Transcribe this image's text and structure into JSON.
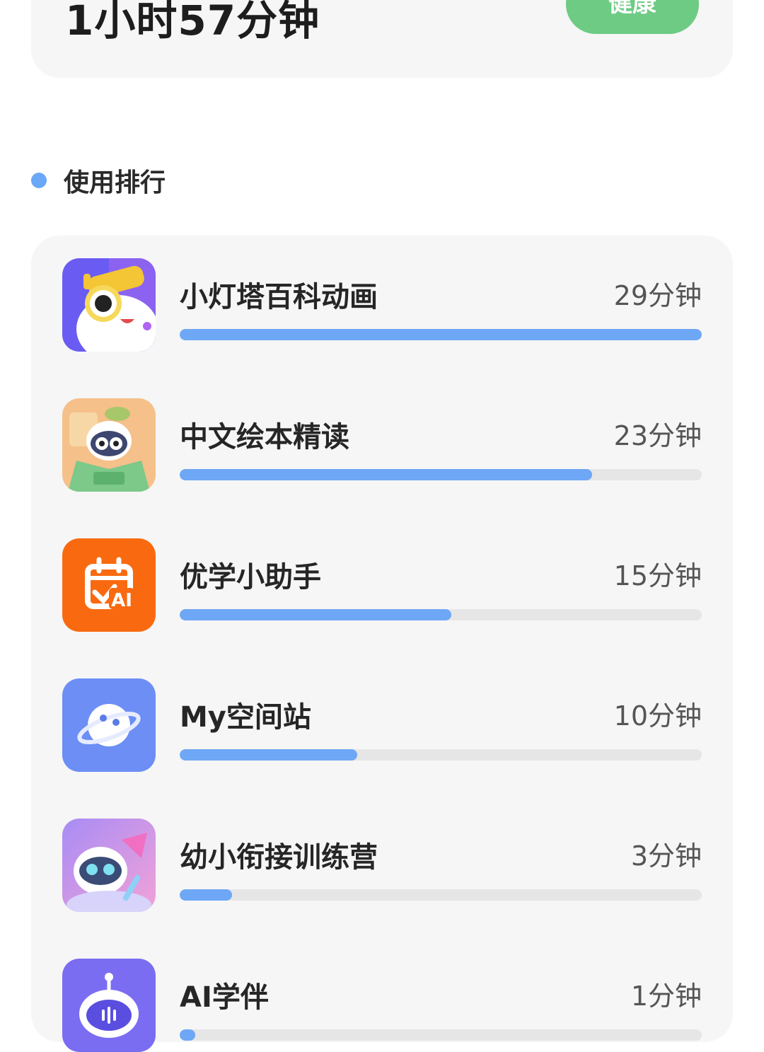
{
  "summary": {
    "total_time": "1小时57分钟",
    "status": "健康",
    "status_color": "#6dcb83"
  },
  "ranking": {
    "title": "使用排行",
    "accent_color": "#6ea7f5",
    "apps": [
      {
        "name": "小灯塔百科动画",
        "time": "29分钟",
        "progress": 1.0,
        "icon": "lighthouse-mascot-icon"
      },
      {
        "name": "中文绘本精读",
        "time": "23分钟",
        "progress": 0.79,
        "icon": "picture-book-mascot-icon"
      },
      {
        "name": "优学小助手",
        "time": "15分钟",
        "progress": 0.52,
        "icon": "ai-calendar-icon"
      },
      {
        "name": "My空间站",
        "time": "10分钟",
        "progress": 0.34,
        "icon": "planet-icon"
      },
      {
        "name": "幼小衔接训练营",
        "time": "3分钟",
        "progress": 0.1,
        "icon": "robot-training-icon"
      },
      {
        "name": "AI学伴",
        "time": "1分钟",
        "progress": 0.03,
        "icon": "ai-robot-icon"
      }
    ]
  }
}
